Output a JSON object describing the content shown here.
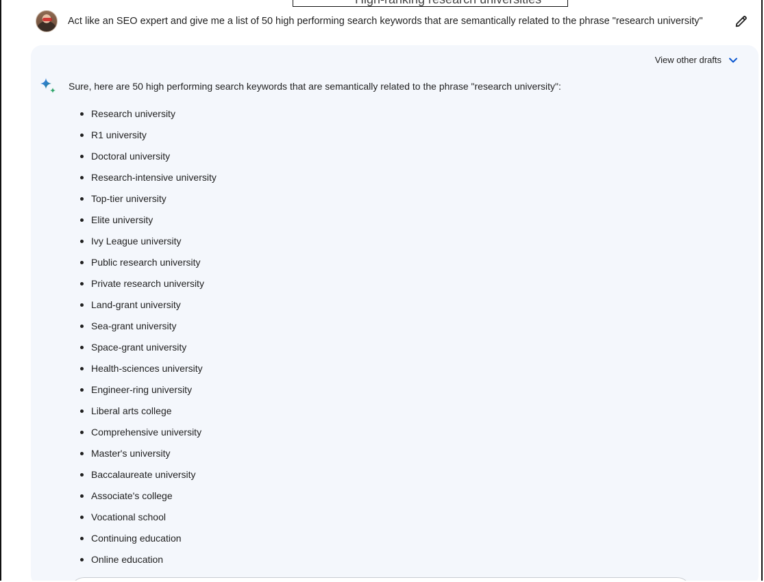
{
  "header": {
    "partial_title": "High-ranking research universities"
  },
  "prompt": {
    "text": "Act like an SEO expert and give me a list of 50 high performing search keywords that are semantically related to the phrase \"research university\""
  },
  "response": {
    "drafts_label": "View other drafts",
    "intro": "Sure, here are 50 high performing search keywords that are semantically related to the phrase \"research university\":",
    "keywords": [
      "Research university",
      "R1 university",
      "Doctoral university",
      "Research-intensive university",
      "Top-tier university",
      "Elite university",
      "Ivy League university",
      "Public research university",
      "Private research university",
      "Land-grant university",
      "Sea-grant university",
      "Space-grant university",
      "Health-sciences university",
      "Engineer-ring university",
      "Liberal arts college",
      "Comprehensive university",
      "Master's university",
      "Baccalaureate university",
      "Associate's college",
      "Vocational school",
      "Continuing education",
      "Online education"
    ]
  },
  "colors": {
    "card_bg": "#f4f7fc",
    "accent_blue": "#0b57d0",
    "text": "#1f1f1f"
  },
  "icons": {
    "avatar": "user-avatar",
    "edit": "pencil-icon",
    "chevron": "chevron-down-icon",
    "assistant": "sparkle-icon"
  }
}
